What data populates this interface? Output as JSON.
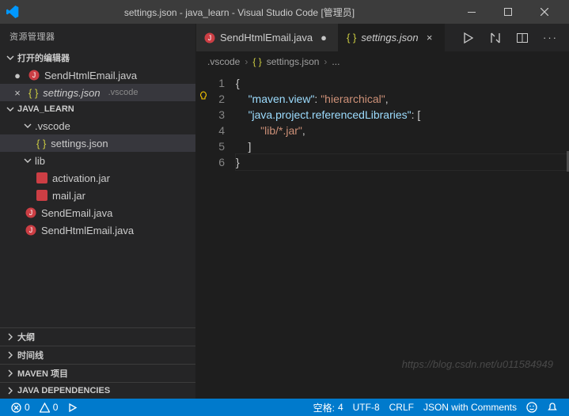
{
  "titlebar": {
    "title": "settings.json - java_learn - Visual Studio Code [管理员]"
  },
  "sidebar": {
    "header": "资源管理器",
    "sections": {
      "openEditors": {
        "label": "打开的编辑器",
        "items": [
          {
            "icon": "java-icon",
            "label": "SendHtmlEmail.java",
            "dirty": true
          },
          {
            "icon": "json-icon",
            "label": "settings.json",
            "detail": ".vscode",
            "active": true
          }
        ]
      },
      "project": {
        "label": "JAVA_LEARN",
        "tree": {
          "vscode": {
            "label": ".vscode",
            "children": [
              {
                "icon": "json-icon",
                "label": "settings.json",
                "active": true
              }
            ]
          },
          "lib": {
            "label": "lib",
            "children": [
              {
                "icon": "red-icon",
                "label": "activation.jar"
              },
              {
                "icon": "red-icon",
                "label": "mail.jar"
              }
            ]
          },
          "files": [
            {
              "icon": "java-icon",
              "label": "SendEmail.java"
            },
            {
              "icon": "java-icon",
              "label": "SendHtmlEmail.java"
            }
          ]
        }
      },
      "collapsed": [
        {
          "label": "大纲"
        },
        {
          "label": "时间线"
        },
        {
          "label": "MAVEN 项目"
        },
        {
          "label": "JAVA DEPENDENCIES"
        }
      ]
    }
  },
  "tabs": [
    {
      "icon": "java-icon",
      "label": "SendHtmlEmail.java",
      "dirty": true,
      "active": false
    },
    {
      "icon": "json-icon",
      "label": "settings.json",
      "dirty": false,
      "active": true,
      "italic": true
    }
  ],
  "breadcrumb": {
    "parts": [
      ".vscode",
      "settings.json",
      "..."
    ]
  },
  "code": {
    "lines": [
      "{",
      "    \"maven.view\": \"hierarchical\",",
      "    \"java.project.referencedLibraries\": [",
      "        \"lib/*.jar\",",
      "    ]",
      "}"
    ]
  },
  "status": {
    "errors": "0",
    "warnings": "0",
    "spaces_label": "空格:",
    "spaces": "4",
    "encoding": "UTF-8",
    "eol": "CRLF",
    "language": "JSON with Comments"
  },
  "watermark": "https://blog.csdn.net/u011584949"
}
